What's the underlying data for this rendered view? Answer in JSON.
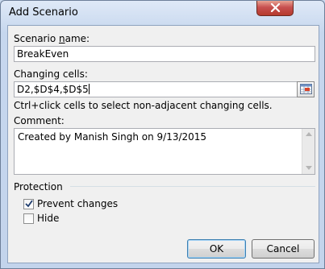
{
  "window": {
    "title": "Add Scenario"
  },
  "scenario_name": {
    "label": "Scenario name:",
    "label_underline_char": "n",
    "value": "BreakEven"
  },
  "changing_cells": {
    "label": "Changing cells:",
    "value": "D2,$D$4,$D$5",
    "hint": "Ctrl+click cells to select non-adjacent changing cells."
  },
  "comment": {
    "label": "Comment:",
    "value": "Created by Manish Singh on 9/13/2015"
  },
  "protection": {
    "heading": "Protection",
    "prevent_changes": {
      "label": "Prevent changes",
      "checked": true
    },
    "hide": {
      "label": "Hide",
      "checked": false
    }
  },
  "buttons": {
    "ok": "OK",
    "cancel": "Cancel"
  },
  "icons": {
    "close": "close-icon",
    "collapse_dialog": "collapse-dialog-icon"
  }
}
